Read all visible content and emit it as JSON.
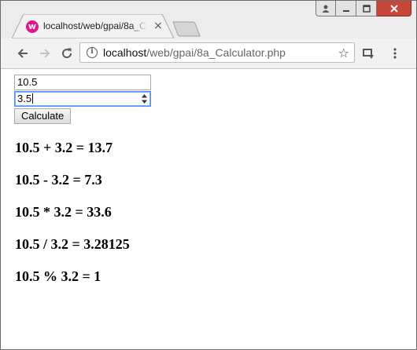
{
  "browser": {
    "tab": {
      "favicon_letter": "w",
      "title": "localhost/web/gpai/8a_Calculator.php",
      "close_glyph": "×"
    },
    "omnibox": {
      "host": "localhost",
      "path": "/web/gpai/8a_Calculator.php"
    },
    "icons": [
      "user-icon",
      "minimize-icon",
      "maximize-icon",
      "close-icon",
      "back-icon",
      "forward-icon",
      "reload-icon",
      "info-icon",
      "star-icon",
      "cast-icon",
      "menu-icon"
    ],
    "colors": {
      "favicon": "#e4138e",
      "close_button": "#c7463a",
      "focus_ring": "#4d90fe"
    }
  },
  "form": {
    "num1_value": "10.5",
    "num2_value": "3.5",
    "calculate_label": "Calculate"
  },
  "results": [
    "10.5 + 3.2 = 13.7",
    "10.5 - 3.2 = 7.3",
    "10.5 * 3.2 = 33.6",
    "10.5 / 3.2 = 3.28125",
    "10.5 % 3.2 = 1"
  ]
}
